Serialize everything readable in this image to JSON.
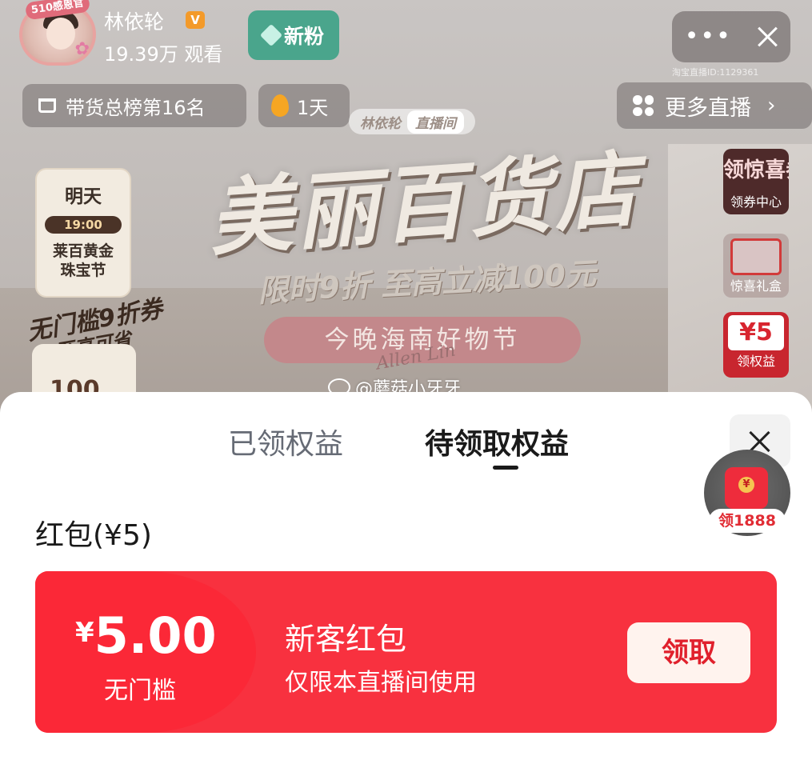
{
  "header": {
    "avatar_badge": "510感恩官",
    "streamer_name": "林依轮",
    "verified_mark": "V",
    "viewers": "19.39万 观看",
    "new_fans_label": "新粉",
    "more_label": "•••",
    "room_id": "淘宝直播ID:1129361"
  },
  "pills": {
    "rank": "带货总榜第16名",
    "streak": "1天",
    "more_live": "更多直播"
  },
  "banner": {
    "tag_name": "林依轮",
    "tag_live": "直播间",
    "title": "美丽百货店",
    "subtitle": "限时9折 至高立减100元",
    "event": "今晚海南好物节",
    "signature": "Allen Lin",
    "watermark": "@蘑菇小牙牙"
  },
  "left_cards": {
    "day": "明天",
    "time": "19:00",
    "event_line1": "莱百黄金",
    "event_line2": "珠宝节",
    "coupon_title": "无门槛9折券",
    "coupon_sub": "至高可省",
    "amount": "100"
  },
  "side_cards": {
    "coupon_center_big": "领惊喜券",
    "coupon_center_label": "领券中心",
    "gift_label": "惊喜礼盒",
    "benefit_amount": "¥5",
    "benefit_label": "领权益"
  },
  "sheet": {
    "tabs": [
      {
        "label": "已领权益",
        "active": false
      },
      {
        "label": "待领取权益",
        "active": true
      }
    ],
    "section_title": "红包(¥5)",
    "float_label": "领1888",
    "coupon": {
      "currency": "¥",
      "value": "5.00",
      "threshold": "无门槛",
      "name": "新客红包",
      "description": "仅限本直播间使用",
      "button": "领取"
    }
  },
  "colors": {
    "coupon_bg": "#f8313f",
    "button_text": "#e0202c",
    "new_fans_bg": "#4aa58c"
  }
}
